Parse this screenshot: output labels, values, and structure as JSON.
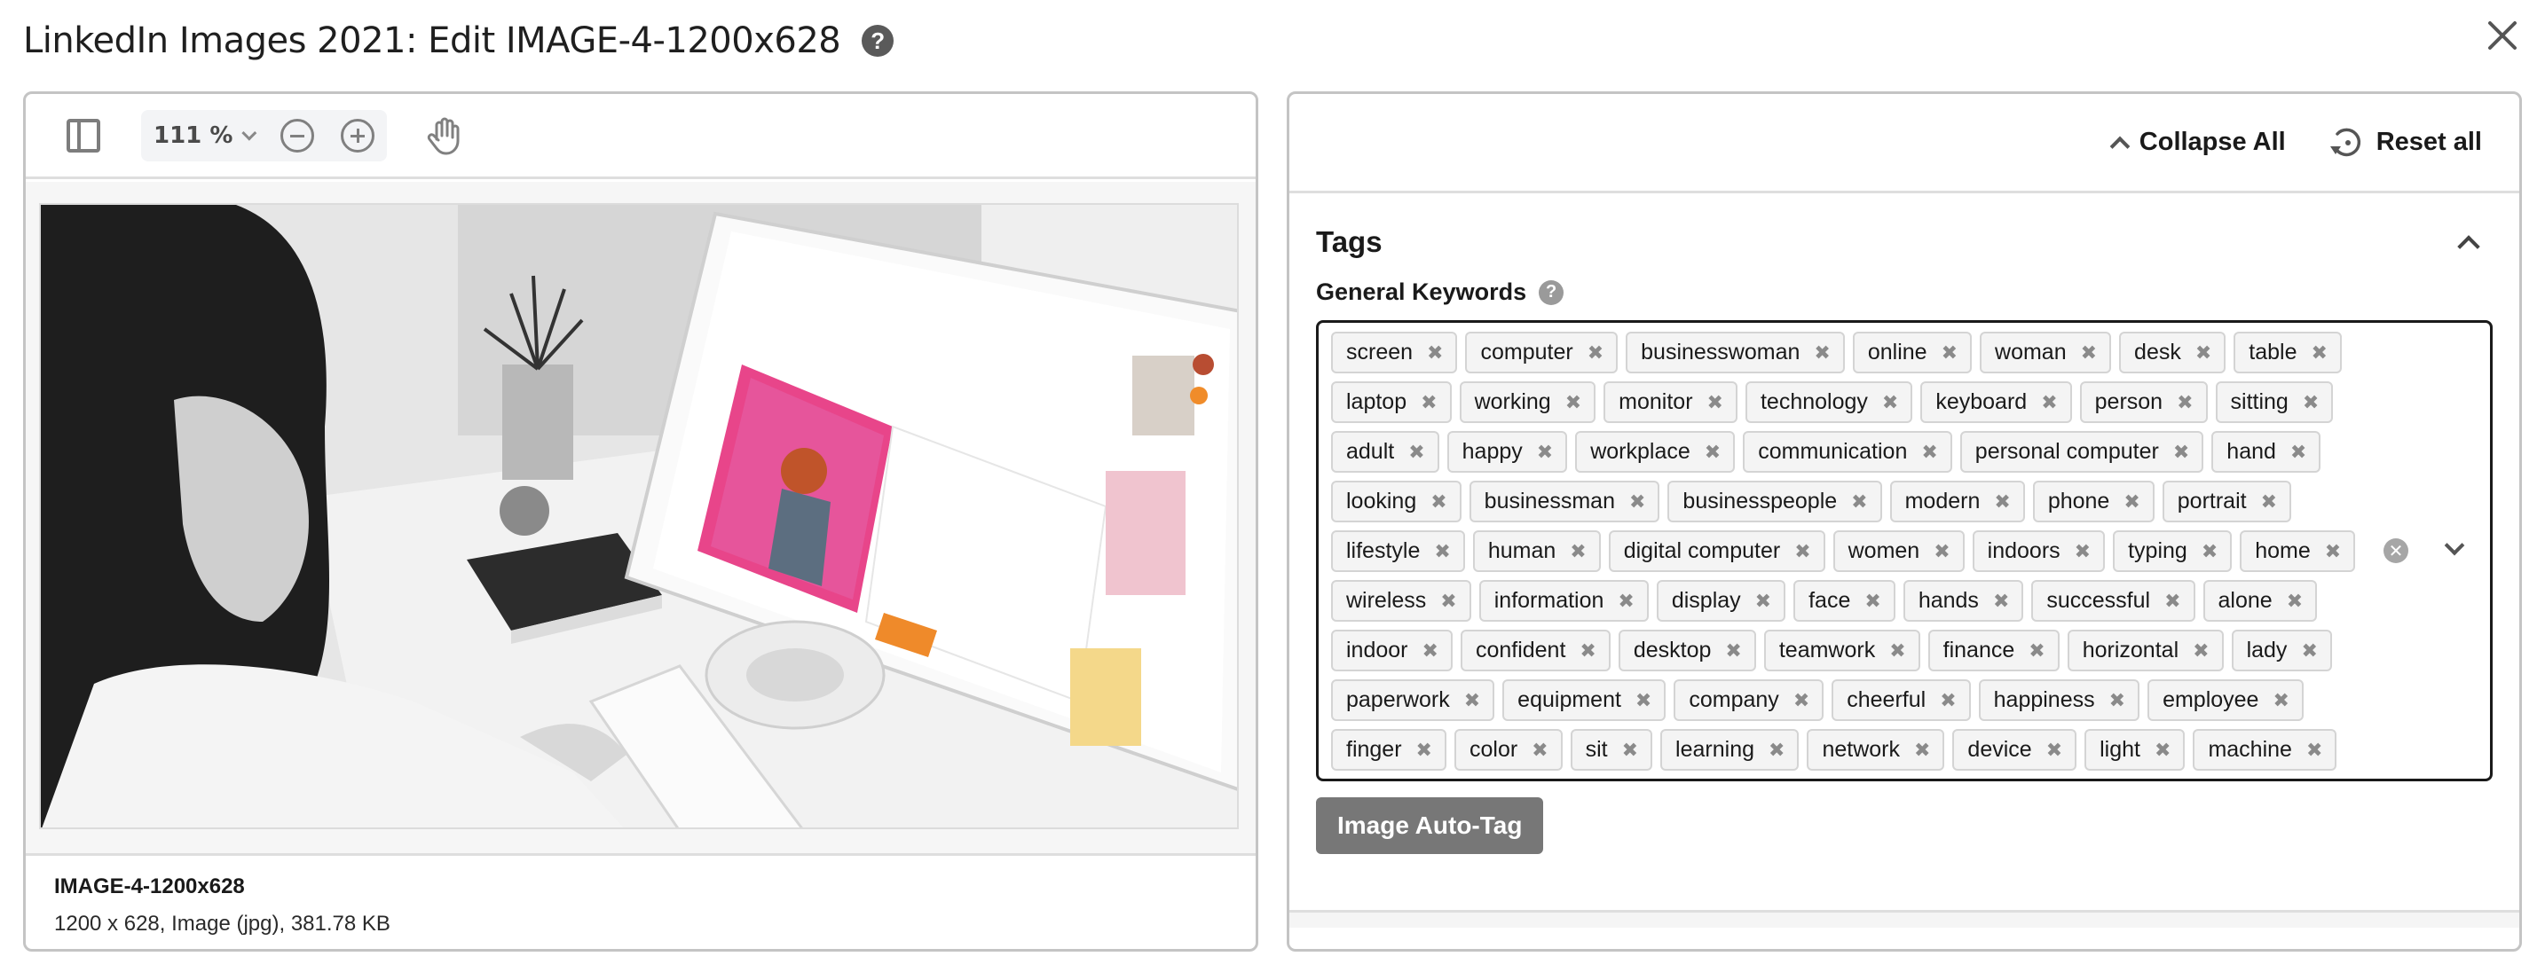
{
  "dialog": {
    "title": "LinkedIn Images 2021: Edit IMAGE-4-1200x628",
    "help_icon": "question-circle-icon",
    "close_icon": "close-icon"
  },
  "viewer": {
    "toolbar": {
      "sidebar_icon": "sidebar-panel-icon",
      "zoom_value": "111 %",
      "zoom_out_icon": "zoom-out-icon",
      "zoom_in_icon": "zoom-in-icon",
      "pan_icon": "hand-icon"
    },
    "image_alt": "Woman at desk using desktop computer showing a Share/Embed Resource dialog",
    "file": {
      "name": "IMAGE-4-1200x628",
      "info": "1200 x 628, Image (jpg), 381.78 KB"
    }
  },
  "editor": {
    "collapse_all_label": "Collapse All",
    "reset_all_label": "Reset all",
    "tags_section": {
      "title": "Tags",
      "field_label": "General Keywords",
      "keywords": [
        "screen",
        "computer",
        "businesswoman",
        "online",
        "woman",
        "desk",
        "table",
        "laptop",
        "working",
        "monitor",
        "technology",
        "keyboard",
        "person",
        "sitting",
        "adult",
        "happy",
        "workplace",
        "communication",
        "personal computer",
        "hand",
        "looking",
        "businessman",
        "businesspeople",
        "modern",
        "phone",
        "portrait",
        "lifestyle",
        "human",
        "digital computer",
        "women",
        "indoors",
        "typing",
        "home",
        "wireless",
        "information",
        "display",
        "face",
        "hands",
        "successful",
        "alone",
        "indoor",
        "confident",
        "desktop",
        "teamwork",
        "finance",
        "horizontal",
        "lady",
        "paperwork",
        "equipment",
        "company",
        "cheerful",
        "happiness",
        "employee",
        "finger",
        "color",
        "sit",
        "learning",
        "network",
        "device",
        "light",
        "machine"
      ],
      "remove_glyph": "✖",
      "auto_tag_label": "Image Auto-Tag"
    }
  },
  "colors": {
    "panel_border": "#c4c4c4",
    "tag_bg": "#f4f4f4",
    "button_grey": "#777777",
    "accent_orange": "#f0932b"
  }
}
